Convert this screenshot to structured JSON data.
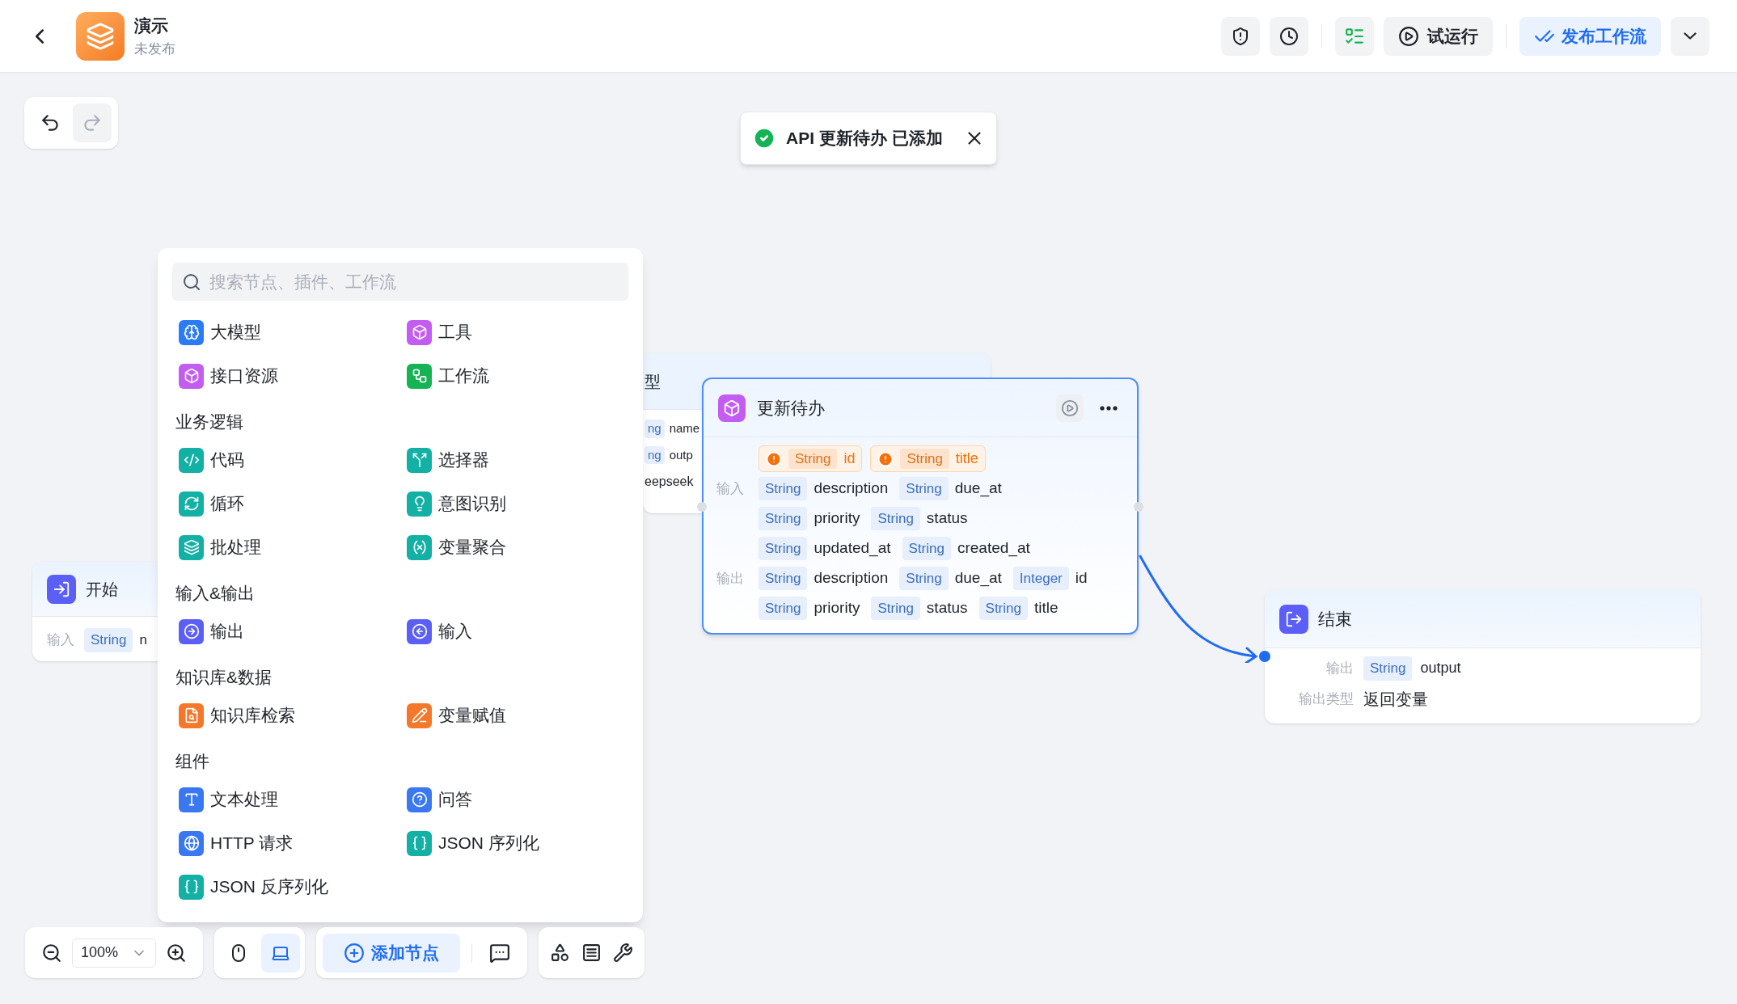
{
  "header": {
    "title": "演示",
    "status": "未发布",
    "run": "试运行",
    "publish": "发布工作流"
  },
  "history": {
    "undo": {
      "disabled": false
    },
    "redo": {
      "disabled": true
    }
  },
  "toast": {
    "message": "API 更新待办 已添加"
  },
  "palette": {
    "search": {
      "placeholder": "搜索节点、插件、工作流"
    },
    "groups": [
      {
        "items": [
          {
            "label": "大模型",
            "color": "#2b7af6"
          },
          {
            "label": "工具",
            "color": "#c35cf0"
          },
          {
            "label": "接口资源",
            "color": "#c35cf0"
          },
          {
            "label": "工作流",
            "color": "#16b355"
          }
        ]
      },
      {
        "title": "业务逻辑",
        "items": [
          {
            "label": "代码",
            "color": "#13b0a5"
          },
          {
            "label": "选择器",
            "color": "#13b0a5"
          },
          {
            "label": "循环",
            "color": "#13b0a5"
          },
          {
            "label": "意图识别",
            "color": "#13b0a5"
          },
          {
            "label": "批处理",
            "color": "#13b0a5"
          },
          {
            "label": "变量聚合",
            "color": "#13b0a5"
          }
        ]
      },
      {
        "title": "输入&输出",
        "items": [
          {
            "label": "输出",
            "color": "#5b5ff6"
          },
          {
            "label": "输入",
            "color": "#5b5ff6"
          }
        ]
      },
      {
        "title": "知识库&数据",
        "items": [
          {
            "label": "知识库检索",
            "color": "#f5782a"
          },
          {
            "label": "变量赋值",
            "color": "#f5782a"
          }
        ]
      },
      {
        "title": "组件",
        "items": [
          {
            "label": "文本处理",
            "color": "#3a78f2"
          },
          {
            "label": "问答",
            "color": "#3a78f2"
          },
          {
            "label": "HTTP 请求",
            "color": "#3a78f2"
          },
          {
            "label": "JSON 序列化",
            "color": "#13b0a5"
          },
          {
            "label": "JSON 反序列化",
            "color": "#13b0a5"
          }
        ]
      }
    ]
  },
  "start_node": {
    "title": "开始",
    "label": "输入",
    "params": [
      {
        "type": "String",
        "name": "n"
      }
    ]
  },
  "hidden_node": {
    "title": "型",
    "params": [
      {
        "type": "ng",
        "name": "name"
      },
      {
        "type": "ng",
        "name": "outp"
      }
    ],
    "model": "eepseek"
  },
  "update_node": {
    "title": "更新待办",
    "required": [
      {
        "type": "String",
        "name": "id"
      },
      {
        "type": "String",
        "name": "title"
      }
    ],
    "sections": [
      {
        "label": "输入",
        "rows": [
          [
            {
              "type": "String",
              "name": "description"
            },
            {
              "type": "String",
              "name": "due_at"
            }
          ],
          [
            {
              "type": "String",
              "name": "priority"
            },
            {
              "type": "String",
              "name": "status"
            }
          ],
          [
            {
              "type": "String",
              "name": "updated_at"
            },
            {
              "type": "String",
              "name": "created_at"
            }
          ]
        ]
      },
      {
        "label": "输出",
        "rows": [
          [
            {
              "type": "String",
              "name": "description"
            },
            {
              "type": "String",
              "name": "due_at"
            },
            {
              "type": "Integer",
              "name": "id"
            }
          ],
          [
            {
              "type": "String",
              "name": "priority"
            },
            {
              "type": "String",
              "name": "status"
            },
            {
              "type": "String",
              "name": "title"
            }
          ]
        ]
      }
    ]
  },
  "end_node": {
    "title": "结束",
    "output_label": "输出",
    "params": [
      {
        "type": "String",
        "name": "output"
      }
    ],
    "type_label": "输出类型",
    "type_value": "返回变量"
  },
  "bottom_toolbar": {
    "zoom": "100%",
    "modes": [
      {
        "selected": false
      },
      {
        "selected": true
      }
    ],
    "add_node": "添加节点"
  }
}
